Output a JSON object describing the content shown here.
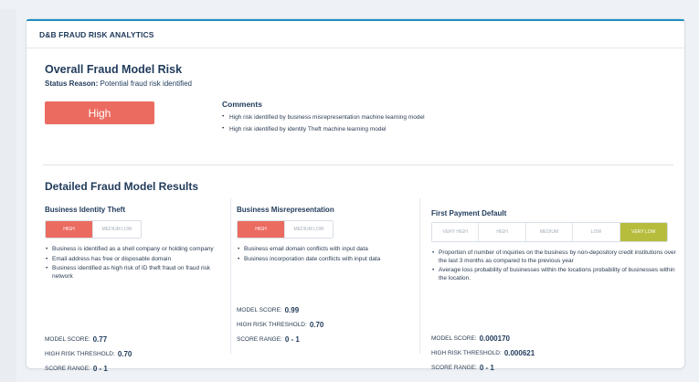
{
  "header": {
    "title": "D&B FRAUD RISK ANALYTICS"
  },
  "overall": {
    "title": "Overall Fraud Model Risk",
    "status_label": "Status Reason:",
    "status_value": "Potential fraud risk identified",
    "risk_level": "High",
    "comments_title": "Comments",
    "comments": [
      "High risk identified by business misrepresentation machine learning model",
      "High risk identified by identity Theft machine learning model"
    ]
  },
  "detailed": {
    "title": "Detailed Fraud Model Results",
    "models": [
      {
        "title": "Business Identity Theft",
        "levels": [
          "High",
          "Medium Low"
        ],
        "active_level": "High",
        "bullets": [
          "Business is identified as a shell company or holding company",
          "Email address has free or disposable domain",
          "Business identified as high risk of ID theft fraud on fraud risk network"
        ],
        "model_score_label": "Model Score:",
        "model_score": "0.77",
        "threshold_label": "High Risk Threshold:",
        "threshold": "0.70",
        "range_label": "Score Range:",
        "range": "0 - 1"
      },
      {
        "title": "Business Misrepresentation",
        "levels": [
          "High",
          "Medium Low"
        ],
        "active_level": "High",
        "bullets": [
          "Business email domain conflicts with input data",
          "Business incorporation date conflicts with input data"
        ],
        "model_score_label": "Model Score:",
        "model_score": "0.99",
        "threshold_label": "High Risk Threshold:",
        "threshold": "0.70",
        "range_label": "Score Range:",
        "range": "0 - 1"
      },
      {
        "title": "First Payment Default",
        "levels": [
          "Very High",
          "High",
          "Medium",
          "Low",
          "Very Low"
        ],
        "active_level": "Very Low",
        "bullets": [
          "Proportion of number of inquiries on the business by non-depository credit institutions over the last 3 months as compared to the previous year",
          "Average loss probability of businesses within the locations probability of businesses within the location."
        ],
        "model_score_label": "Model Score:",
        "model_score": "0.000170",
        "threshold_label": "High Risk Threshold:",
        "threshold": "0.000621",
        "range_label": "Score Range:",
        "range": "0 - 1"
      }
    ]
  },
  "colors": {
    "high": "#ec6b60",
    "very_low": "#b6bd3c",
    "accent_line": "#1f8fbf",
    "text_dark": "#1f3a5a"
  }
}
